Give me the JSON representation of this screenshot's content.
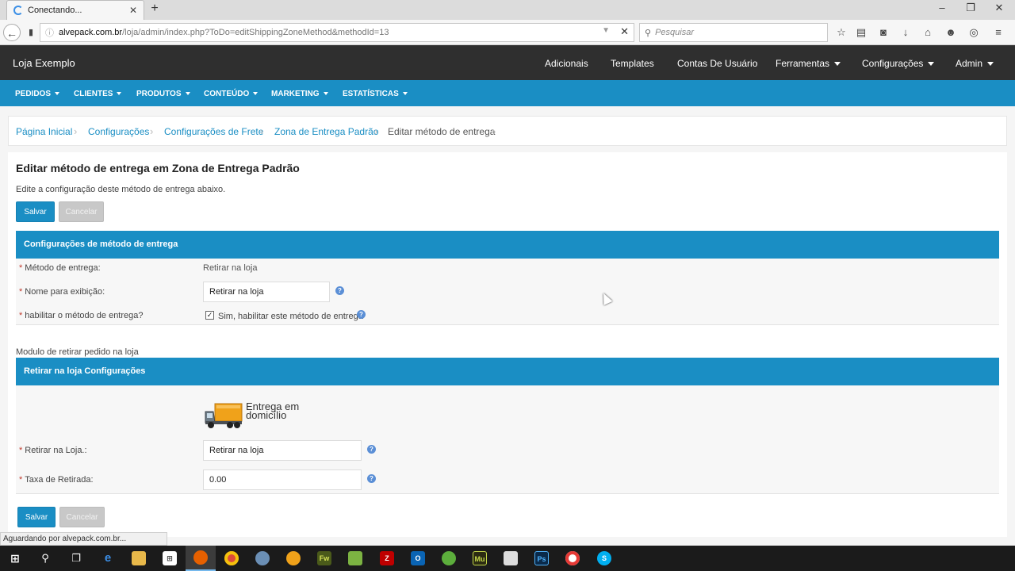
{
  "browser": {
    "tab_title": "Conectando...",
    "url_host": "alvepack.com.br",
    "url_path": "/loja/admin/index.php?ToDo=editShippingZoneMethod&methodId=13",
    "search_placeholder": "Pesquisar",
    "status_text": "Aguardando por alvepack.com.br..."
  },
  "header": {
    "store_name": "Loja Exemplo",
    "nav": [
      {
        "label": "Adicionais"
      },
      {
        "label": "Templates"
      },
      {
        "label": "Contas De Usuário"
      },
      {
        "label": "Ferramentas"
      },
      {
        "label": "Configurações"
      },
      {
        "label": "Admin"
      }
    ]
  },
  "menu": [
    {
      "label": "PEDIDOS"
    },
    {
      "label": "CLIENTES"
    },
    {
      "label": "PRODUTOS"
    },
    {
      "label": "CONTEÚDO"
    },
    {
      "label": "MARKETING"
    },
    {
      "label": "ESTATÍSTICAS"
    }
  ],
  "breadcrumb": [
    {
      "label": "Página Inicial"
    },
    {
      "label": "Configurações"
    },
    {
      "label": "Configurações de Frete"
    },
    {
      "label": "Zona de Entrega Padrão"
    },
    {
      "label": "Editar método de entrega"
    }
  ],
  "page": {
    "title": "Editar método de entrega em Zona de Entrega Padrão",
    "description": "Edite a configuração deste método de entrega abaixo.",
    "save_label": "Salvar",
    "cancel_label": "Cancelar"
  },
  "method_settings": {
    "heading": "Configurações de método de entrega",
    "method_label": "Método de entrega:",
    "method_value": "Retirar na loja",
    "display_name_label": "Nome para exibição:",
    "display_name_value": "Retirar na loja",
    "enable_label": "habilitar o método de entrega?",
    "enable_text": "Sim, habilitar este método de entrega",
    "enable_checked": true
  },
  "module": {
    "note": "Modulo de retirar pedido na loja",
    "heading": "Retirar na loja Configurações",
    "logo_text_line1": "Entrega em",
    "logo_text_line2": "domicílio",
    "pickup_label": "Retirar na Loja.:",
    "pickup_value": "Retirar na loja",
    "fee_label": "Taxa de Retirada:",
    "fee_value": "0.00"
  },
  "colors": {
    "accent": "#1a8ec4",
    "header_bg": "#2f2f2f",
    "required": "#c0392b"
  },
  "taskbar_icons": [
    "windows-start-icon",
    "search-icon",
    "task-view-icon",
    "edge-icon",
    "file-explorer-icon",
    "store-icon",
    "firefox-icon",
    "chrome-icon",
    "app-icon",
    "app-icon",
    "fireworks-icon",
    "app-icon",
    "filezilla-icon",
    "outlook-icon",
    "app-icon",
    "muse-icon",
    "app-icon",
    "photoshop-icon",
    "app-icon",
    "skype-icon"
  ]
}
